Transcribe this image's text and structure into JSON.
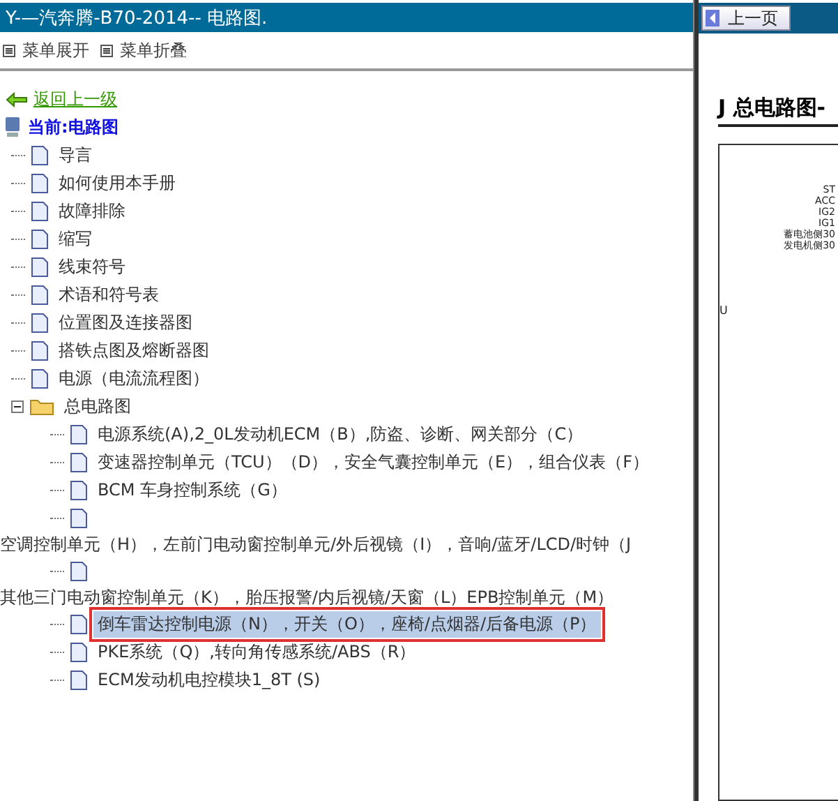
{
  "left_panel": {
    "title": "Y-—汽奔腾-B70-2014-- 电路图.",
    "menu": [
      {
        "label": "菜单展开"
      },
      {
        "label": "菜单折叠"
      }
    ],
    "back_link": "返回上一级",
    "current": "当前:电路图",
    "tree": [
      {
        "label": "导言",
        "kind": "page",
        "selected": false
      },
      {
        "label": "如何使用本手册",
        "kind": "page",
        "selected": false
      },
      {
        "label": "故障排除",
        "kind": "page",
        "selected": false
      },
      {
        "label": "缩写",
        "kind": "page",
        "selected": false
      },
      {
        "label": "线束符号",
        "kind": "page",
        "selected": false
      },
      {
        "label": "术语和符号表",
        "kind": "page",
        "selected": false
      },
      {
        "label": "位置图及连接器图",
        "kind": "page",
        "selected": false
      },
      {
        "label": "搭铁点图及熔断器图",
        "kind": "page",
        "selected": false
      },
      {
        "label": "电源（电流流程图）",
        "kind": "page",
        "selected": false
      },
      {
        "label": "总电路图",
        "kind": "folder",
        "expanded": true,
        "selected": false,
        "children": [
          {
            "label": "电源系统(A),2_0L发动机ECM（B）,防盗、诊断、网关部分（C）",
            "kind": "page",
            "selected": false
          },
          {
            "label": "变速器控制单元（TCU）（D），安全气囊控制单元（E），组合仪表（F）",
            "kind": "page",
            "selected": false
          },
          {
            "label": "BCM 车身控制系统（G）",
            "kind": "page",
            "selected": false
          },
          {
            "label": "空调控制单元（H），左前门电动窗控制单元/外后视镜（I），音响/蓝牙/LCD/时钟（J",
            "kind": "wrapped",
            "selected": false
          },
          {
            "label": "其他三门电动窗控制单元（K），胎压报警/内后视镜/天窗（L）EPB控制单元（M）",
            "kind": "wrapped",
            "selected": false
          },
          {
            "label": "倒车雷达控制电源（N），开关（O），座椅/点烟器/后备电源（P）",
            "kind": "page",
            "selected": true
          },
          {
            "label": "PKE系统（Q）,转向角传感系统/ABS（R）",
            "kind": "page",
            "selected": false
          },
          {
            "label": "ECM发动机电控模块1_8T (S)",
            "kind": "page",
            "selected": false
          }
        ]
      }
    ]
  },
  "right_panel": {
    "prev_button": "上一页",
    "doc_title": "J 总电路图-",
    "labels": [
      "ST",
      "ACC",
      "IG2",
      "IG1",
      "蓄电池侧30",
      "发电机侧30"
    ],
    "side_label": "U"
  }
}
